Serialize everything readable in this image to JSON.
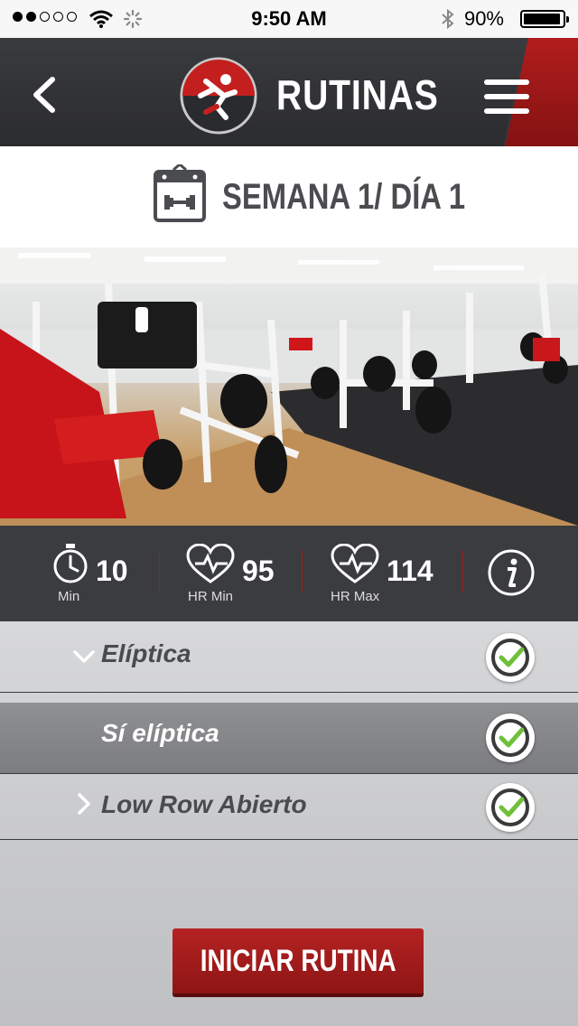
{
  "status_bar": {
    "time": "9:50 AM",
    "battery": "90%",
    "signal_bars_filled": 2,
    "signal_bars_total": 5
  },
  "header": {
    "title": "RUTINAS",
    "back_icon": "chevron-left-icon",
    "menu_icon": "hamburger-menu-icon",
    "logo_icon": "runner-logo-icon"
  },
  "week": {
    "label": "SEMANA 1/ DÍA 1",
    "icon": "calendar-dumbbell-icon"
  },
  "stats": [
    {
      "icon": "stopwatch-icon",
      "value": "10",
      "label": "Min"
    },
    {
      "icon": "heart-rate-icon",
      "value": "95",
      "label": "HR Min"
    },
    {
      "icon": "heart-rate-icon",
      "value": "114",
      "label": "HR Max"
    }
  ],
  "info_icon": "info-icon",
  "exercises": [
    {
      "label": "Elíptica",
      "expanded": true,
      "chevron": "chevron-down-icon",
      "done": true
    },
    {
      "label": "Sí elíptica",
      "selected": true,
      "done": true
    },
    {
      "label": "Low Row Abierto",
      "expanded": false,
      "chevron": "chevron-right-icon",
      "done": true
    }
  ],
  "start_button": "INICIAR RUTINA",
  "colors": {
    "accent_red": "#b52222",
    "header_dark": "#2f3033",
    "check_green": "#6fbf3a"
  }
}
